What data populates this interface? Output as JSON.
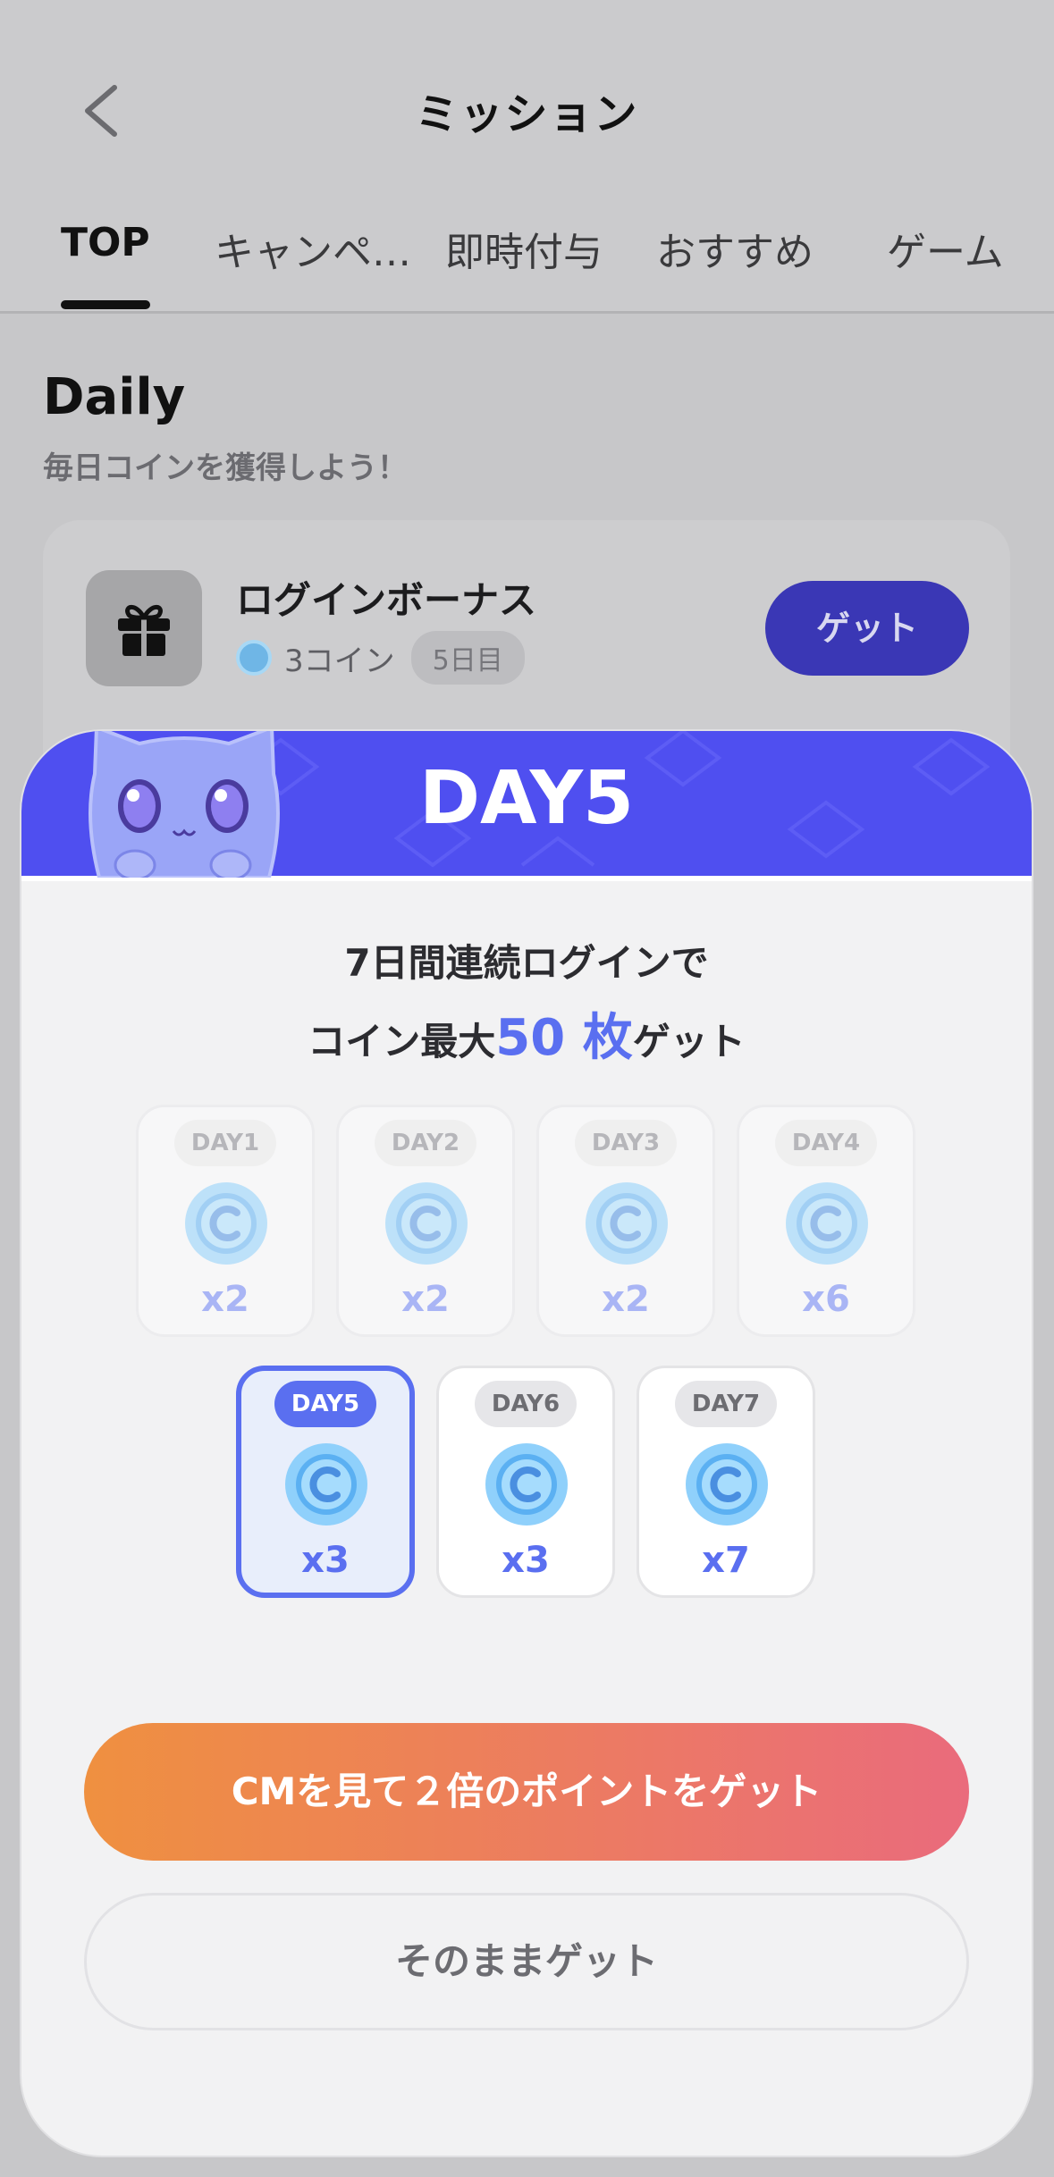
{
  "header": {
    "title": "ミッション"
  },
  "tabs": [
    {
      "label": "TOP",
      "active": true
    },
    {
      "label": "キャンペ…"
    },
    {
      "label": "即時付与"
    },
    {
      "label": "おすすめ"
    },
    {
      "label": "ゲーム"
    }
  ],
  "daily": {
    "title": "Daily",
    "subtitle": "毎日コインを獲得しよう！",
    "card": {
      "title": "ログインボーナス",
      "coins": "3コイン",
      "day_badge": "5日目",
      "button": "ゲット"
    }
  },
  "modal": {
    "banner_title": "DAY5",
    "line1": "7日間連続ログインで",
    "line2_pre": "コイン最大",
    "line2_accent": "50 枚",
    "line2_post": "ゲット",
    "days": [
      {
        "label": "DAY1",
        "mult": "x2",
        "state": "past"
      },
      {
        "label": "DAY2",
        "mult": "x2",
        "state": "past"
      },
      {
        "label": "DAY3",
        "mult": "x2",
        "state": "past"
      },
      {
        "label": "DAY4",
        "mult": "x6",
        "state": "past"
      },
      {
        "label": "DAY5",
        "mult": "x3",
        "state": "current"
      },
      {
        "label": "DAY6",
        "mult": "x3",
        "state": "future"
      },
      {
        "label": "DAY7",
        "mult": "x7",
        "state": "future"
      }
    ],
    "cm_button": "CMを見て２倍のポイントをゲット",
    "plain_button": "そのままゲット"
  },
  "colors": {
    "accent": "#5a6ff0",
    "banner": "#4f4ff0",
    "get_button": "#3a37b5",
    "cm_gradient_start": "#ef9040",
    "cm_gradient_end": "#ea6b7c"
  }
}
